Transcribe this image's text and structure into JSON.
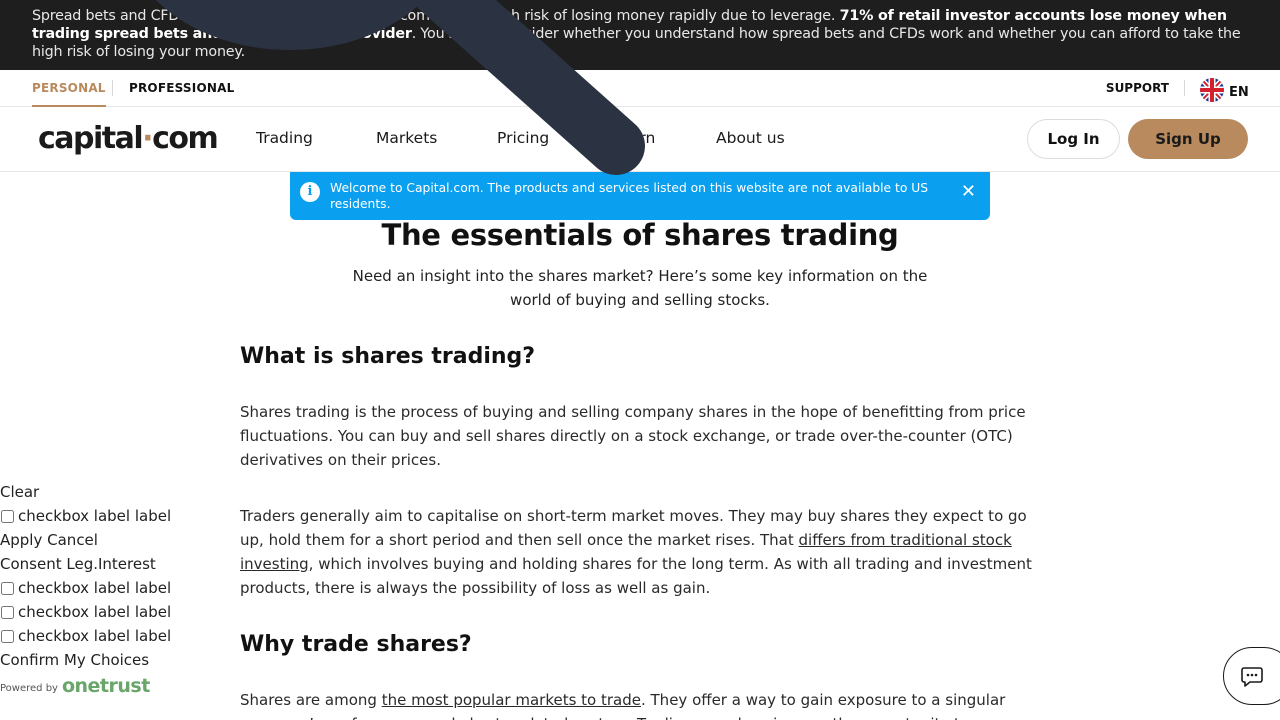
{
  "risk_banner": {
    "text_a": "Spread bets and CFDs are complex instruments and come with a high risk of losing money rapidly due to leverage. ",
    "text_bold": "71% of retail investor accounts lose money when trading spread bets and CFDs with this provider",
    "text_b": ". You should consider whether you understand how spread bets and CFDs work and whether you can afford to take the high risk of losing your money."
  },
  "audience": {
    "personal": "PERSONAL",
    "professional": "PROFESSIONAL",
    "support": "SUPPORT",
    "language": "EN"
  },
  "nav": {
    "logo_left": "capital",
    "logo_dot": "·",
    "logo_right": "com",
    "items": [
      "Trading",
      "Markets",
      "Pricing",
      "Learn",
      "About us"
    ],
    "login": "Log In",
    "signup": "Sign Up"
  },
  "notice": {
    "text": "Welcome to Capital.com. The products and services listed on this website are not available to US residents.",
    "info_glyph": "i",
    "close_glyph": "✕"
  },
  "article": {
    "title": "The essentials of shares trading",
    "intro": "Need an insight into the shares market? Here’s some key information on the world of buying and selling stocks.",
    "h2_1": "What is shares trading?",
    "p1": "Shares trading is the process of buying and selling company shares in the hope of benefitting from price fluctuations. You can buy and sell shares directly on a stock exchange, or trade over-the-counter (OTC) derivatives on their prices.",
    "p2_a": "Traders generally aim to capitalise on short-term market moves. They may buy shares they expect to go up, hold them for a short period and then sell once the market rises. That ",
    "p2_link": "differs from traditional stock investing",
    "p2_b": ", which involves buying and holding shares for the long term. As with all trading and investment products, there is always the possibility of loss as well as gain.",
    "h2_2": "Why trade shares?",
    "p3_a": "Shares are among ",
    "p3_link": "the most popular markets to trade",
    "p3_b": ". They offer a way to gain exposure to a singular company’s performance and also to related sectors. Trading can also give you the opportunity to"
  },
  "consent": {
    "clear": "Clear",
    "checkbox_label": "checkbox label label",
    "apply": "Apply",
    "cancel": "Cancel",
    "consent": "Consent",
    "leg_interest": "Leg.Interest",
    "confirm": "Confirm My Choices",
    "powered_by": "Powered by",
    "onetrust": "onetrust"
  },
  "icons": {
    "flag": "uk-flag-icon",
    "info": "info-icon",
    "close": "close-icon",
    "chat": "chat-icon",
    "magnifier": "magnifier-cursor-icon"
  },
  "colors": {
    "accent": "#b98a5e",
    "notice": "#0aa0ef",
    "banner": "#1e1e1e",
    "overlay": "#2b3342"
  }
}
